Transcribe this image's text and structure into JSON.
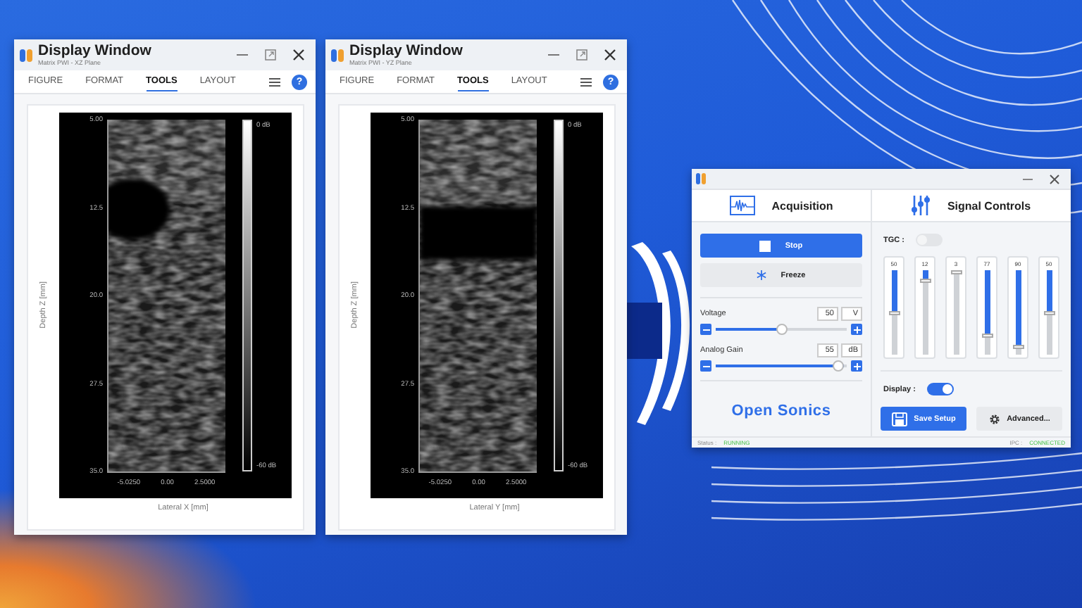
{
  "windows": [
    {
      "title": "Display Window",
      "subtitle": "Matrix PWI - XZ Plane",
      "tabs": [
        {
          "label": "FIGURE",
          "selected": false
        },
        {
          "label": "FORMAT",
          "selected": false
        },
        {
          "label": "TOOLS",
          "selected": true
        },
        {
          "label": "LAYOUT",
          "selected": false
        }
      ],
      "help": "?",
      "plot": {
        "ylabel": "Depth Z [mm]",
        "xlabel": "Lateral X [mm]",
        "yticks": [
          "5.00",
          "12.5",
          "20.0",
          "27.5",
          "35.0"
        ],
        "xticks": [
          "-5.0250",
          "0.00",
          "2.5000"
        ],
        "colorbar": [
          "0 dB",
          "-60 dB"
        ],
        "kind": "circle"
      }
    },
    {
      "title": "Display Window",
      "subtitle": "Matrix PWI - YZ Plane",
      "tabs": [
        {
          "label": "FIGURE",
          "selected": false
        },
        {
          "label": "FORMAT",
          "selected": false
        },
        {
          "label": "TOOLS",
          "selected": true
        },
        {
          "label": "LAYOUT",
          "selected": false
        }
      ],
      "help": "?",
      "plot": {
        "ylabel": "Depth Z [mm]",
        "xlabel": "Lateral Y [mm]",
        "yticks": [
          "5.00",
          "12.5",
          "20.0",
          "27.5",
          "35.0"
        ],
        "xticks": [
          "-5.0250",
          "0.00",
          "2.5000"
        ],
        "colorbar": [
          "0 dB",
          "-60 dB"
        ],
        "kind": "band"
      }
    }
  ],
  "control_panel": {
    "acquisition": {
      "title": "Acquisition",
      "buttons": [
        {
          "label": "Stop",
          "kind": "primary"
        },
        {
          "label": "Freeze",
          "kind": "secondary"
        }
      ],
      "sliders": [
        {
          "label": "Voltage",
          "value": "50",
          "unit": "V",
          "level": 0.5
        },
        {
          "label": "Analog Gain",
          "value": "55",
          "unit": "dB",
          "level": 0.98
        }
      ],
      "logo": "Open Sonics",
      "status_label": "Status :",
      "status": "RUNNING"
    },
    "signal_controls": {
      "title": "Signal Controls",
      "tgc": {
        "label": "TGC :",
        "on": false
      },
      "sliders": [
        {
          "value": "50",
          "level": 0.5
        },
        {
          "value": "12",
          "level": 0.12
        },
        {
          "value": "3",
          "level": 0.03
        },
        {
          "value": "77",
          "level": 0.77
        },
        {
          "value": "90",
          "level": 0.9
        },
        {
          "value": "50",
          "level": 0.5
        }
      ],
      "display": {
        "label": "Display :",
        "on": true
      },
      "buttons": [
        {
          "label": "Save Setup",
          "kind": "primary"
        },
        {
          "label": "Advanced...",
          "kind": "secondary"
        }
      ],
      "status_label": "IPC :",
      "status": "CONNECTED"
    }
  }
}
